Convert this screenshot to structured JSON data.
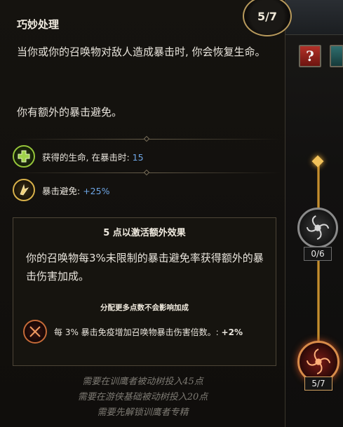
{
  "skill": {
    "title": "巧妙处理",
    "rank": "5/7",
    "description_1": "当你或你的召唤物对敌人造成暴击时, 你会恢复生命。",
    "description_2": "你有额外的暴击避免。"
  },
  "stats": [
    {
      "label": "获得的生命, 在暴击时:",
      "value": "15",
      "icon": "green-cross-icon"
    },
    {
      "label": "暴击避免:",
      "value": "+25%",
      "icon": "dodge-icon"
    }
  ],
  "bonus": {
    "title": "5 点以激活额外效果",
    "description": "你的召唤物每3%未限制的暴击避免率获得额外的暴击伤害加成。",
    "note": "分配更多点数不会影响加成",
    "effect_label": "每 3% 暴击免疫增加召唤物暴击伤害倍数。:",
    "effect_value": "+2%",
    "effect_icon": "crossed-daggers-icon"
  },
  "requirements": [
    "需要在训鹰者被动树投入45点",
    "需要在游侠基础被动树投入20点",
    "需要先解锁训鹰者专精"
  ],
  "tree": {
    "help_label": "?",
    "node_a_progress": "0/6",
    "node_b_progress": "5/7"
  },
  "colors": {
    "stat_value": "#6ea6e6",
    "gold_accent": "#e0a53a",
    "requirement_text": "#7d7a73"
  }
}
